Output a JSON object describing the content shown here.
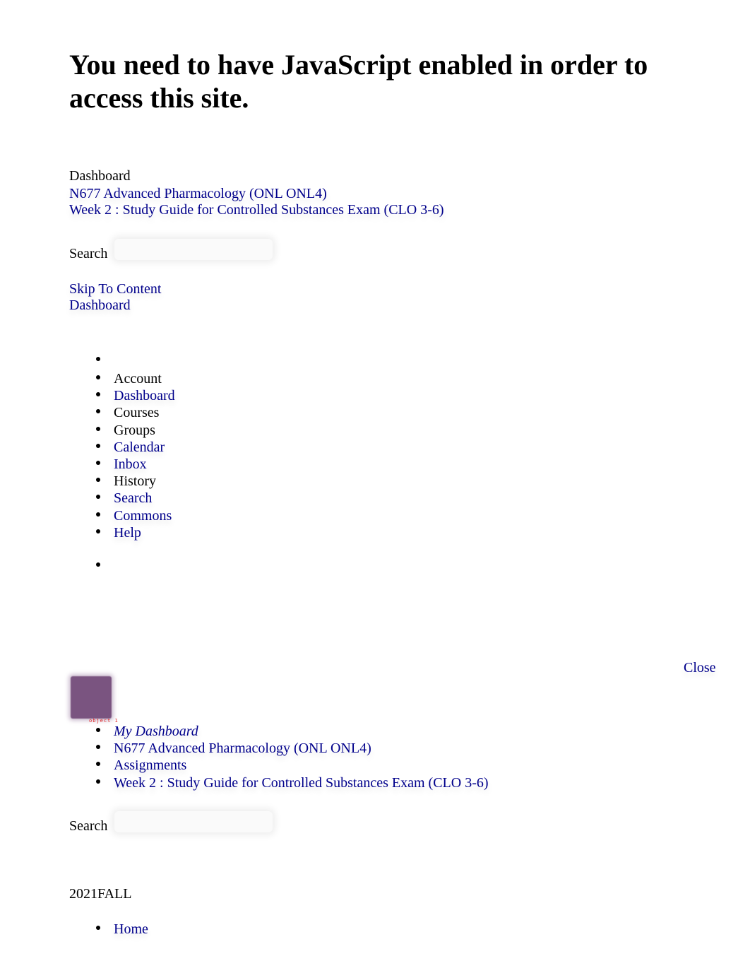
{
  "noscript_message": "You need to have JavaScript enabled in order to access this site.",
  "breadcrumb": {
    "items": [
      {
        "label": "Dashboard",
        "link": false
      },
      {
        "label": "N677 Advanced Pharmacology (ONL ONL4)",
        "link": true
      },
      {
        "label": "Week 2 : Study Guide for Controlled Substances Exam (CLO 3-6)",
        "link": true
      }
    ]
  },
  "search_top": {
    "label": "Search",
    "value": "",
    "placeholder": ""
  },
  "skip_to_content": "Skip To Content",
  "dashboard_link": "Dashboard",
  "global_nav": {
    "items": [
      {
        "label": "Account",
        "link": false
      },
      {
        "label": "Dashboard",
        "link": true
      },
      {
        "label": "Courses",
        "link": false
      },
      {
        "label": "Groups",
        "link": false
      },
      {
        "label": "Calendar",
        "link": true
      },
      {
        "label": "Inbox",
        "link": true
      },
      {
        "label": "History",
        "link": false
      },
      {
        "label": "Search",
        "link": true
      },
      {
        "label": "Commons",
        "link": true
      },
      {
        "label": "Help",
        "link": true
      }
    ]
  },
  "close_label": "Close",
  "avatar_caption": "object 1",
  "mobile_breadcrumb": {
    "items": [
      {
        "label": "My Dashboard"
      },
      {
        "label": "N677 Advanced Pharmacology (ONL ONL4)"
      },
      {
        "label": "Assignments"
      },
      {
        "label": "Week 2 : Study Guide for Controlled Substances Exam (CLO 3-6)"
      }
    ]
  },
  "search_bottom": {
    "label": "Search",
    "value": "",
    "placeholder": ""
  },
  "term": "2021FALL",
  "course_nav": {
    "items": [
      {
        "label": "Home"
      }
    ]
  },
  "colors": {
    "link": "#00008b",
    "text": "#000000",
    "avatar": "#7a5480",
    "caption": "#e02020"
  }
}
